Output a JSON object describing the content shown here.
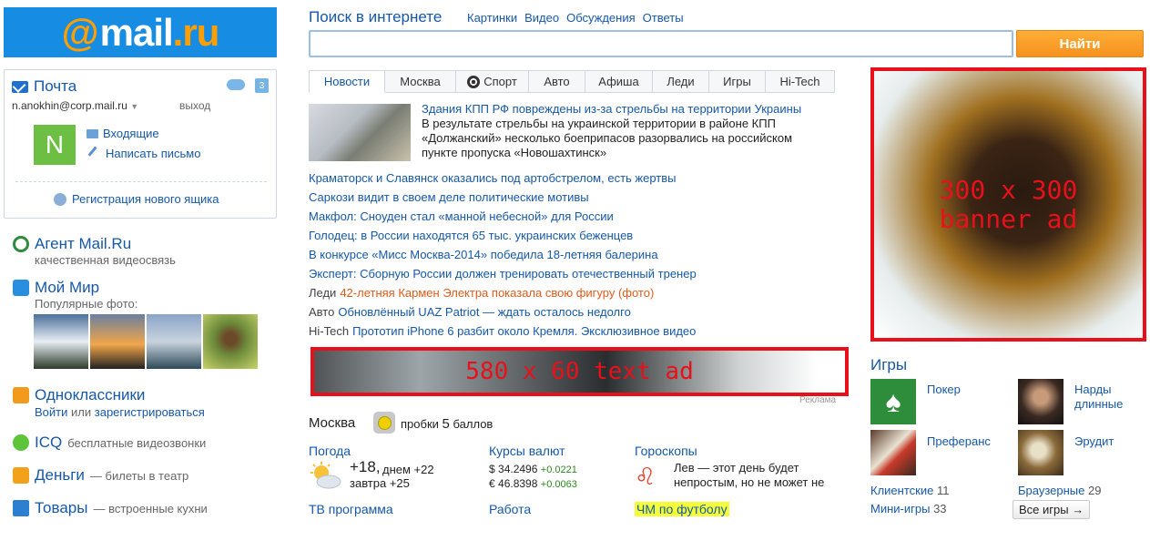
{
  "logo": {
    "at": "@",
    "mail": "mail",
    "dot": ".",
    "ru": "ru"
  },
  "mailbox": {
    "title": "Почта",
    "calendar_day": "3",
    "email": "n.anokhin@corp.mail.ru",
    "logout": "выход",
    "avatar_letter": "N",
    "inbox": "Входящие",
    "write": "Написать письмо",
    "register": "Регистрация нового ящика"
  },
  "services": {
    "agent": {
      "title": "Агент Mail.Ru",
      "sub": "качественная видеосвязь"
    },
    "mymir": {
      "title": "Мой Мир",
      "sub": "Популярные фото:"
    },
    "ok": {
      "title": "Одноклассники",
      "login": "Войти",
      "or": "или",
      "register": "зарегистрироваться"
    },
    "icq": {
      "title": "ICQ",
      "sub": "бесплатные видеозвонки"
    },
    "money": {
      "title": "Деньги",
      "sub": "— билеты в театр"
    },
    "goods": {
      "title": "Товары",
      "sub": "— встроенные кухни"
    }
  },
  "search": {
    "title": "Поиск в интернете",
    "links": [
      "Картинки",
      "Видео",
      "Обсуждения",
      "Ответы"
    ],
    "value": "",
    "button": "Найти"
  },
  "tabs": [
    "Новости",
    "Москва",
    "Спорт",
    "Авто",
    "Афиша",
    "Леди",
    "Игры",
    "Hi-Tech"
  ],
  "news": {
    "lead_title": "Здания КПП РФ повреждены из-за стрельбы на территории Украины",
    "lead_text": "В результате стрельбы на украинской территории в районе КПП «Должанский» несколько боеприпасов разорвались на российском пункте пропуска «Новошахтинск»",
    "items": [
      {
        "cat": "",
        "text": "Краматорск и Славянск оказались под артобстрелом, есть жертвы"
      },
      {
        "cat": "",
        "text": "Саркози видит в своем деле политические мотивы"
      },
      {
        "cat": "",
        "text": "Макфол: Сноуден стал «манной небесной» для России"
      },
      {
        "cat": "",
        "text": "Голодец: в России находятся 65 тыс. украинских беженцев"
      },
      {
        "cat": "",
        "text": "В конкурсе «Мисс Москва-2014» победила 18-летняя балерина"
      },
      {
        "cat": "",
        "text": "Эксперт: Сборную России должен тренировать отечественный тренер"
      },
      {
        "cat": "Леди",
        "text": "42-летняя Кармен Электра показала свою фигуру (фото)"
      },
      {
        "cat": "Авто",
        "text": "Обновлённый UAZ Patriot — ждать осталось недолго"
      },
      {
        "cat": "Hi-Tech",
        "text": "Прототип iPhone 6 разбит около Кремля. Эксклюзивное видео"
      }
    ]
  },
  "text_ad": {
    "label": "580 x 60 text ad",
    "reklama": "Реклама"
  },
  "traffic": {
    "city": "Москва",
    "label": "пробки",
    "score": "5",
    "unit": "баллов"
  },
  "weather": {
    "title": "Погода",
    "now": "+18,",
    "day": "днем +22",
    "tomorrow": "завтра +25"
  },
  "currency": {
    "title": "Курсы валют",
    "rows": [
      {
        "sym": "$",
        "value": "34.2496",
        "delta": "+0.0221"
      },
      {
        "sym": "€",
        "value": "46.8398",
        "delta": "+0.0063"
      }
    ]
  },
  "horoscope": {
    "title": "Гороскопы",
    "sign": "♌",
    "text": "Лев — этот день будет непростым, но не может не"
  },
  "bottom_links": {
    "tv": "ТВ программа",
    "work": "Работа",
    "football": "ЧМ по футболу"
  },
  "banner": {
    "line1": "300 x 300",
    "line2": "banner ad"
  },
  "games": {
    "title": "Игры",
    "items": [
      "Покер",
      "Нарды длинные",
      "Преферанс",
      "Эрудит"
    ],
    "stats": [
      {
        "label": "Клиентские",
        "count": "11"
      },
      {
        "label": "Браузерные",
        "count": "29"
      },
      {
        "label": "Мини-игры",
        "count": "33"
      }
    ],
    "all": "Все игры →"
  }
}
